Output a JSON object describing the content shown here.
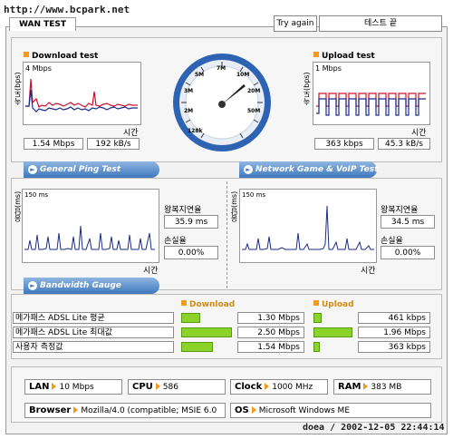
{
  "watermark": "http://www.bcpark.net",
  "signature": "doea / 2002-12-05 22:44:14",
  "tab_label": "WAN TEST",
  "try_again_label": "Try again",
  "status_text": "테스트 끝",
  "speedometer": {
    "labels": [
      "128k",
      "2M",
      "3M",
      "5M",
      "7M",
      "10M",
      "20M",
      "50M"
    ]
  },
  "download": {
    "title": "Download test",
    "axis_unit": "속도(bps)",
    "scale": "4 Mbps",
    "time_label": "시간",
    "speed": "1.54 Mbps",
    "rate": "192 kB/s"
  },
  "upload": {
    "title": "Upload test",
    "axis_unit": "속도(bps)",
    "scale": "1 Mbps",
    "time_label": "시간",
    "speed": "363 kbps",
    "rate": "45.3 kB/s"
  },
  "ping_banner": "General Ping Test",
  "game_banner": "Network Game & VoIP Test",
  "bandwidth_banner": "Bandwidth Gauge",
  "ping": {
    "axis_unit": "응답(ms)",
    "scale": "150 ms",
    "time_label": "시간",
    "latency_label": "왕복지연율",
    "latency": "35.9 ms",
    "loss_label": "손실율",
    "loss": "0.00%"
  },
  "game": {
    "axis_unit": "응답(ms)",
    "scale": "150 ms",
    "time_label": "시간",
    "latency_label": "왕복지연율",
    "latency": "34.5 ms",
    "loss_label": "손실율",
    "loss": "0.00%"
  },
  "gauge": {
    "download_header": "Download",
    "upload_header": "Upload",
    "rows": [
      {
        "label": "메가패스 ADSL Lite 평균",
        "download": "1.30 Mbps",
        "download_fill": 0.36,
        "upload": "461 kbps",
        "upload_fill": 0.2
      },
      {
        "label": "메가패스 ADSL Lite 최대값",
        "download": "2.50 Mbps",
        "download_fill": 0.96,
        "upload": "1.96 Mbps",
        "upload_fill": 0.98
      },
      {
        "label": "사용자 측정값",
        "download": "1.54 Mbps",
        "download_fill": 0.6,
        "upload": "363 kbps",
        "upload_fill": 0.15
      }
    ]
  },
  "system": {
    "lan_label": "LAN",
    "lan": "10 Mbps",
    "cpu_label": "CPU",
    "cpu": "586",
    "clock_label": "Clock",
    "clock": "1000 MHz",
    "ram_label": "RAM",
    "ram": "383 MB",
    "browser_label": "Browser",
    "browser": "Mozilla/4.0 (compatible; MSIE 6.0",
    "os_label": "OS",
    "os": "Microsoft Windows ME"
  }
}
